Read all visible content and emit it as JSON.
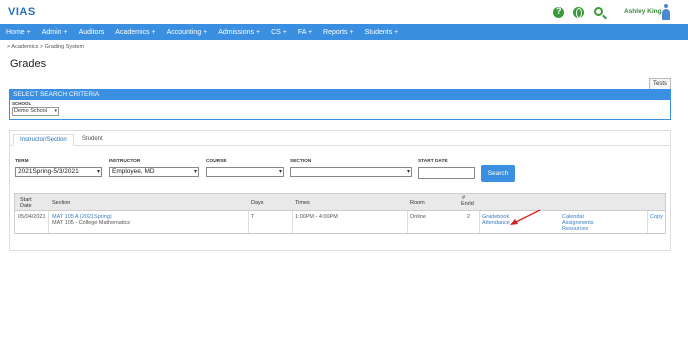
{
  "app": {
    "logo": "VIAS"
  },
  "topbar": {
    "user_name": "Ashley King"
  },
  "nav": [
    "Home +",
    "Admin +",
    "Auditors",
    "Academics +",
    "Accounting +",
    "Admissions +",
    "CS +",
    "FA +",
    "Reports +",
    "Students +"
  ],
  "breadcrumb": "> Academics  > Grading System",
  "page_title": "Grades",
  "tests_tab": "Tests",
  "criteria": {
    "header": "SELECT SEARCH CRITERIA",
    "school_label": "SCHOOL",
    "school_value": "Demo School"
  },
  "tabs": {
    "active": "Instructor/Section",
    "inactive": "Student"
  },
  "filters": {
    "term_label": "TERM",
    "term_value": "2021Spring-5/3/2021",
    "instructor_label": "INSTRUCTOR",
    "instructor_value": "Employee, MD",
    "course_label": "COURSE",
    "course_value": "",
    "section_label": "SECTION",
    "section_value": "",
    "start_date_label": "START DATE",
    "start_date_value": "",
    "search_label": "Search"
  },
  "table": {
    "headers": {
      "start_date_1": "Start",
      "start_date_2": "Date",
      "section": "Section",
      "days": "Days",
      "times": "Times",
      "room": "Room",
      "enrld_1": "#",
      "enrld_2": "Enrld"
    },
    "row": {
      "start_date": "05/04/2021",
      "section_link": "MAT 105 A (2021Spring)",
      "section_name": "MAT 105 - College Mathematics",
      "days": "T",
      "times": "1:00PM - 4:00PM",
      "room": "Online",
      "enrld": "2",
      "gradebook": "Gradebook",
      "attendance": "Attendance",
      "calendar": "Calendar",
      "assignments": "Assignments",
      "resources": "Resources",
      "copy": "Copy"
    }
  },
  "colors": {
    "accent": "#3a8fe0",
    "link": "#3a7cc0",
    "annotation": "#d42020"
  }
}
